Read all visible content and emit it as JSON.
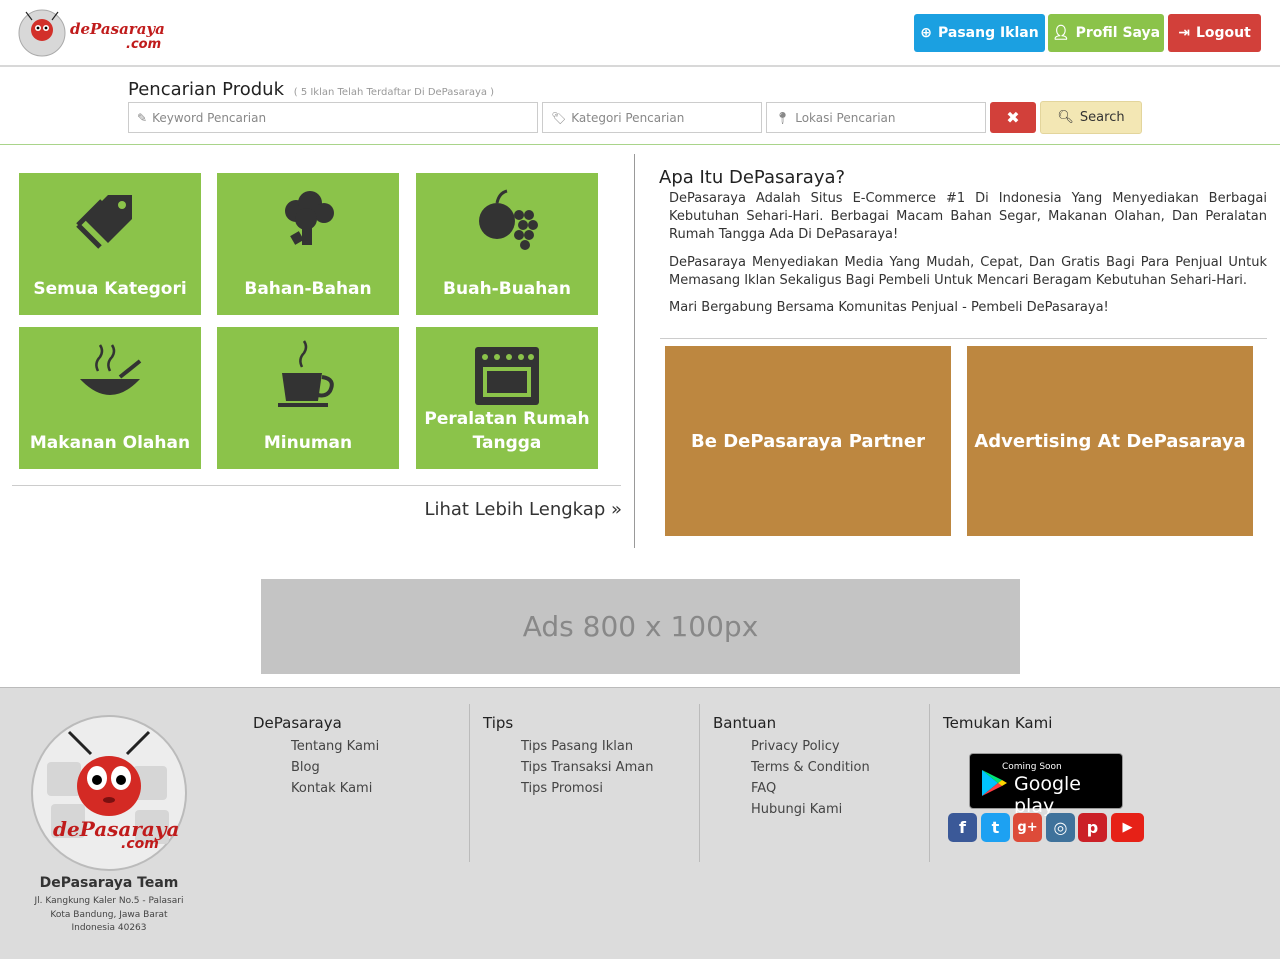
{
  "header": {
    "logo_text": "dePasaraya.com",
    "buttons": {
      "post_ad": "Pasang Iklan",
      "profile": "Profil Saya",
      "logout": "Logout"
    }
  },
  "search": {
    "title": "Pencarian Produk",
    "subtitle": "( 5 Iklan Telah Terdaftar Di DePasaraya )",
    "keyword_placeholder": "Keyword Pencarian",
    "category_placeholder": "Kategori Pencarian",
    "location_placeholder": "Lokasi Pencarian",
    "search_label": "Search"
  },
  "categories": [
    {
      "label": "Semua Kategori",
      "icon": "tags-icon"
    },
    {
      "label": "Bahan-Bahan",
      "icon": "broccoli-icon"
    },
    {
      "label": "Buah-Buahan",
      "icon": "fruits-icon"
    },
    {
      "label": "Makanan Olahan",
      "icon": "food-bowl-icon"
    },
    {
      "label": "Minuman",
      "icon": "coffee-cup-icon"
    },
    {
      "label": "Peralatan Rumah Tangga",
      "icon": "oven-icon"
    }
  ],
  "more_link": "Lihat Lebih Lengkap",
  "about": {
    "title": "Apa Itu DePasaraya?",
    "p1": "DePasaraya Adalah Situs E-Commerce #1 Di Indonesia Yang Menyediakan Berbagai Kebutuhan Sehari-Hari. Berbagai Macam Bahan Segar, Makanan Olahan, Dan Peralatan Rumah Tangga Ada Di DePasaraya!",
    "p2": "DePasaraya Menyediakan Media Yang Mudah, Cepat, Dan Gratis Bagi Para Penjual Untuk Memasang Iklan Sekaligus Bagi Pembeli Untuk Mencari Beragam Kebutuhan Sehari-Hari.",
    "p3": "Mari Bergabung Bersama Komunitas Penjual - Pembeli DePasaraya!"
  },
  "promos": {
    "partner": "Be DePasaraya Partner",
    "advertising": "Advertising At DePasaraya"
  },
  "ads": "Ads 800 x 100px",
  "footer": {
    "team": "DePasaraya Team",
    "address": [
      "Jl. Kangkung Kaler No.5 - Palasari",
      "Kota Bandung, Jawa Barat",
      "Indonesia 40263"
    ],
    "columns": [
      {
        "title": "DePasaraya",
        "links": [
          "Tentang Kami",
          "Blog",
          "Kontak Kami"
        ]
      },
      {
        "title": "Tips",
        "links": [
          "Tips Pasang Iklan",
          "Tips Transaksi Aman",
          "Tips Promosi"
        ]
      },
      {
        "title": "Bantuan",
        "links": [
          "Privacy Policy",
          "Terms & Condition",
          "FAQ",
          "Hubungi Kami"
        ]
      }
    ],
    "find_us": "Temukan Kami",
    "google_play": {
      "coming_soon": "Coming Soon",
      "name": "Google play"
    },
    "social": [
      {
        "name": "facebook-icon",
        "color": "#3b5998",
        "glyph": "f"
      },
      {
        "name": "twitter-icon",
        "color": "#1da1f2",
        "glyph": "t"
      },
      {
        "name": "google-plus-icon",
        "color": "#dd4b39",
        "glyph": "g+"
      },
      {
        "name": "instagram-icon",
        "color": "#3f729b",
        "glyph": "◎"
      },
      {
        "name": "pinterest-icon",
        "color": "#cb2027",
        "glyph": "p"
      },
      {
        "name": "youtube-icon",
        "color": "#e62117",
        "glyph": "▶"
      }
    ]
  },
  "colors": {
    "tile_green": "#8bc34a",
    "promo_brown": "#bd8740",
    "blue": "#1ba0e1",
    "red": "#d2403a"
  }
}
